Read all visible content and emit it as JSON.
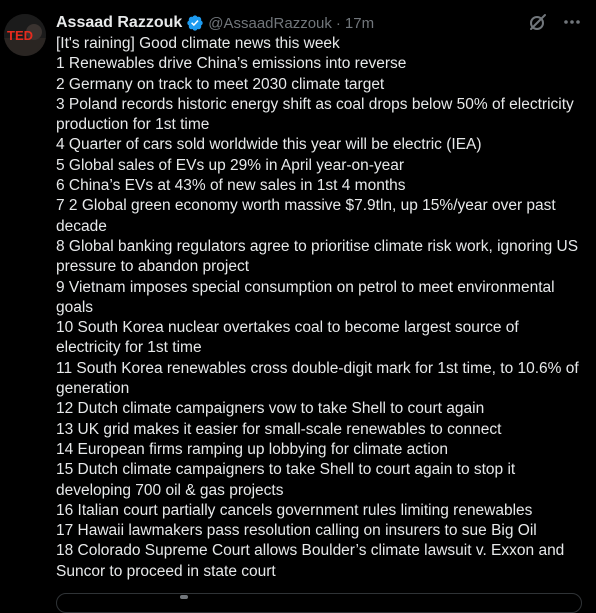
{
  "author": {
    "display_name": "Assaad Razzouk",
    "handle": "@AssaadRazzouk",
    "separator": "·",
    "time": "17m",
    "avatar_text": "TED",
    "verified_icon": "verified-badge-icon",
    "verified_color": "#1d9bf0"
  },
  "actions": {
    "grok_icon": "grok-icon",
    "more_icon": "more-icon"
  },
  "tweet": {
    "lines": [
      "[It's raining] Good climate news this week",
      "1 Renewables drive China’s emissions into reverse",
      "2 Germany on track to meet 2030 climate target",
      "3 Poland records historic energy shift as coal drops below 50% of electricity production for 1st time",
      "4 Quarter of cars sold worldwide this year will be electric (IEA)",
      "5 Global sales of EVs up 29% in April year-on-year",
      "6 China’s EVs at 43% of new sales in 1st 4 months",
      "7 2 Global green economy worth massive $7.9tln, up 15%/year over past decade",
      "8 Global banking regulators agree to prioritise climate risk work, ignoring US pressure to abandon project",
      "9 Vietnam imposes special consumption on petrol to meet environmental goals",
      "10 South Korea nuclear overtakes coal to become largest source of electricity for 1st time",
      "11 South Korea renewables cross double-digit mark for 1st time, to 10.6% of generation",
      "12 Dutch climate campaigners vow to take Shell to court again",
      "13 UK grid makes it easier for small-scale renewables to connect",
      "14 European firms ramping up lobbying for climate action",
      "15 Dutch climate campaigners to take Shell to court again to stop it developing 700 oil & gas projects",
      "16 Italian court partially cancels government rules limiting renewables",
      "17 Hawaii lawmakers pass resolution calling on insurers to sue Big Oil",
      "18 Colorado Supreme Court allows Boulder’s climate lawsuit v. Exxon and Suncor to proceed in state court"
    ]
  },
  "colors": {
    "background": "#000000",
    "text": "#e7e9ea",
    "secondary_text": "#71767b",
    "avatar_accent": "#e62b1e"
  }
}
